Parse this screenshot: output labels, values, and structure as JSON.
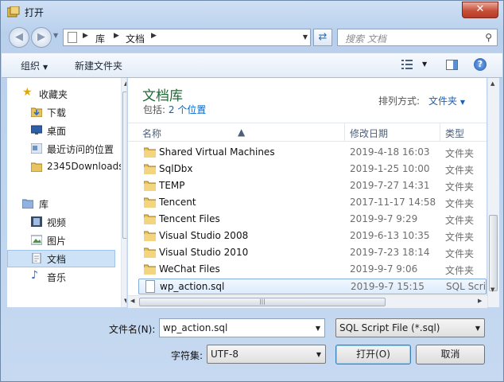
{
  "window": {
    "title": "打开",
    "close_glyph": "✕"
  },
  "nav": {
    "back_glyph": "◀",
    "forward_glyph": "▶",
    "breadcrumb": [
      "库",
      "文档"
    ],
    "search_placeholder": "搜索 文档"
  },
  "toolbar": {
    "organize": "组织",
    "new_folder": "新建文件夹",
    "help_glyph": "?"
  },
  "sidebar": {
    "items": [
      {
        "label": "收藏夹",
        "icon": "star-icon"
      },
      {
        "label": "下载",
        "icon": "download-folder-icon"
      },
      {
        "label": "桌面",
        "icon": "desktop-icon"
      },
      {
        "label": "最近访问的位置",
        "icon": "recent-places-icon"
      },
      {
        "label": "2345Downloads",
        "icon": "folder-icon"
      },
      {
        "label": "库",
        "icon": "library-icon"
      },
      {
        "label": "视频",
        "icon": "video-icon"
      },
      {
        "label": "图片",
        "icon": "pictures-icon"
      },
      {
        "label": "文档",
        "icon": "documents-icon",
        "selected": true
      },
      {
        "label": "音乐",
        "icon": "music-icon"
      }
    ]
  },
  "library": {
    "title": "文档库",
    "includes_label": "包括:",
    "includes_link": "2 个位置",
    "arrange_label": "排列方式:",
    "arrange_value": "文件夹"
  },
  "columns": {
    "name": "名称",
    "modified": "修改日期",
    "type": "类型"
  },
  "files": [
    {
      "name": "Shared Virtual Machines",
      "date": "2019-4-18 16:03",
      "type": "文件夹",
      "kind": "folder"
    },
    {
      "name": "SqlDbx",
      "date": "2019-1-25 10:00",
      "type": "文件夹",
      "kind": "folder"
    },
    {
      "name": "TEMP",
      "date": "2019-7-27 14:31",
      "type": "文件夹",
      "kind": "folder"
    },
    {
      "name": "Tencent",
      "date": "2017-11-17 14:58",
      "type": "文件夹",
      "kind": "folder"
    },
    {
      "name": "Tencent Files",
      "date": "2019-9-7 9:29",
      "type": "文件夹",
      "kind": "folder"
    },
    {
      "name": "Visual Studio 2008",
      "date": "2019-6-13 10:35",
      "type": "文件夹",
      "kind": "folder"
    },
    {
      "name": "Visual Studio 2010",
      "date": "2019-7-23 18:14",
      "type": "文件夹",
      "kind": "folder"
    },
    {
      "name": "WeChat Files",
      "date": "2019-9-7 9:06",
      "type": "文件夹",
      "kind": "folder"
    },
    {
      "name": "wp_action.sql",
      "date": "2019-9-7 15:15",
      "type": "SQL Script",
      "kind": "file",
      "selected": true
    }
  ],
  "footer": {
    "filename_label": "文件名(N):",
    "filename_value": "wp_action.sql",
    "filter_value": "SQL Script File (*.sql)",
    "encoding_label": "字符集:",
    "encoding_value": "UTF-8",
    "open_button": "打开(O)",
    "cancel_button": "取消"
  },
  "colors": {
    "accent": "#1e6a36",
    "link": "#1b5fb3",
    "selection": "#cde1f7"
  }
}
